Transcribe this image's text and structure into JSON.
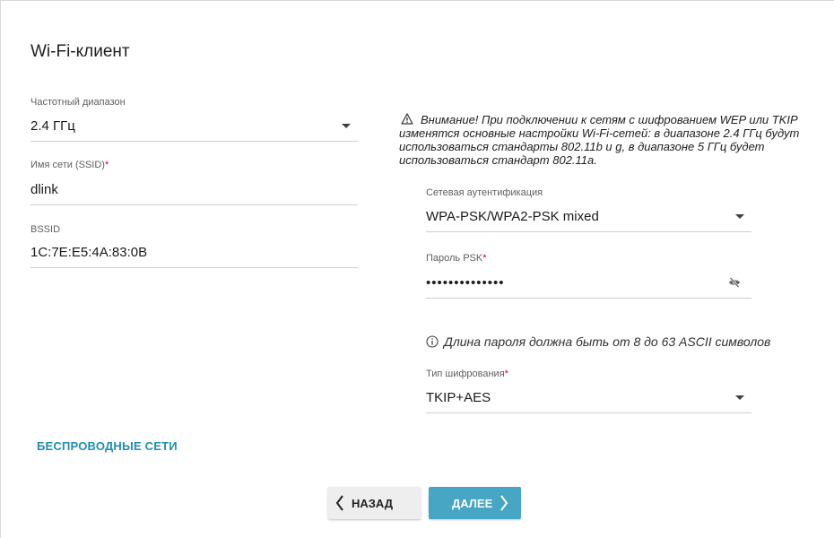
{
  "page": {
    "title": "Wi-Fi-клиент"
  },
  "left": {
    "band": {
      "label": "Частотный диапазон",
      "value": "2.4 ГГц"
    },
    "ssid": {
      "label": "Имя сети (SSID)",
      "required_mark": "*",
      "value": "dlink"
    },
    "bssid": {
      "label": "BSSID",
      "value": "1C:7E:E5:4A:83:0B"
    }
  },
  "right": {
    "warning": "Внимание! При подключении к сетям с шифрованием WEP или TKIP изменятся основные настройки Wi-Fi-сетей: в диапазоне 2.4 ГГц будут использоваться стандарты 802.11b и g, в диапазоне 5 ГГц будет использоваться стандарт 802.11a.",
    "auth": {
      "label": "Сетевая аутентификация",
      "value": "WPA-PSK/WPA2-PSK mixed"
    },
    "psk": {
      "label": "Пароль PSK",
      "required_mark": "*",
      "value": "••••••••••••••",
      "icon": "eye-off-icon"
    },
    "psk_hint": "Длина пароля должна быть от 8 до 63 ASCII символов",
    "cipher": {
      "label": "Тип шифрования",
      "required_mark": "*",
      "value": "TKIP+AES"
    }
  },
  "link": {
    "label": "БЕСПРОВОДНЫЕ СЕТИ"
  },
  "buttons": {
    "back_label": "НАЗАД",
    "next_label": "ДАЛЕЕ"
  },
  "colors": {
    "accent": "#46a6c4",
    "link": "#1e8fb0",
    "required": "#d0021b"
  }
}
